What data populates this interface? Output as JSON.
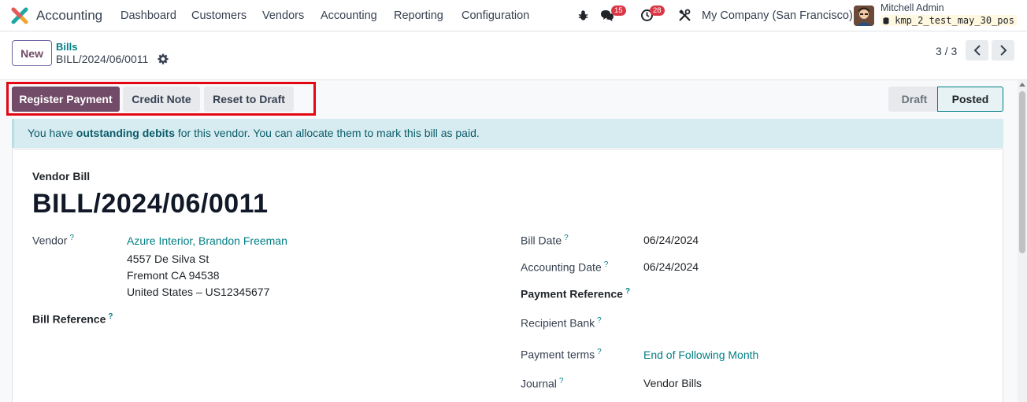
{
  "navbar": {
    "app_name": "Accounting",
    "menu": [
      "Dashboard",
      "Customers",
      "Vendors",
      "Accounting",
      "Reporting",
      "Configuration"
    ],
    "messages_badge": "15",
    "activities_badge": "28",
    "company": "My Company (San Francisco)",
    "user_name": "Mitchell Admin",
    "database": "kmp_2_test_may_30_pos"
  },
  "control_panel": {
    "new_label": "New",
    "breadcrumb": "Bills",
    "record_name": "BILL/2024/06/0011",
    "pager": "3 / 3"
  },
  "actions": {
    "register_payment": "Register Payment",
    "credit_note": "Credit Note",
    "reset_to_draft": "Reset to Draft"
  },
  "status": {
    "draft": "Draft",
    "posted": "Posted",
    "current": "Posted"
  },
  "alert": {
    "prefix": "You have ",
    "bold": "outstanding debits",
    "suffix": " for this vendor. You can allocate them to mark this bill as paid."
  },
  "form": {
    "type_label": "Vendor Bill",
    "title": "BILL/2024/06/0011",
    "vendor_label": "Vendor",
    "vendor_name": "Azure Interior, Brandon Freeman",
    "vendor_address": [
      "4557 De Silva St",
      "Fremont CA 94538",
      "United States – US12345677"
    ],
    "bill_reference_label": "Bill Reference",
    "bill_date_label": "Bill Date",
    "bill_date": "06/24/2024",
    "accounting_date_label": "Accounting Date",
    "accounting_date": "06/24/2024",
    "payment_reference_label": "Payment Reference",
    "recipient_bank_label": "Recipient Bank",
    "payment_terms_label": "Payment terms",
    "payment_terms": "End of Following Month",
    "journal_label": "Journal",
    "journal": "Vendor Bills",
    "help_mark": "?"
  },
  "colors": {
    "primary": "#714b67",
    "link": "#017e84",
    "alert_bg": "#d6ecf0",
    "highlight": "#e30613"
  }
}
